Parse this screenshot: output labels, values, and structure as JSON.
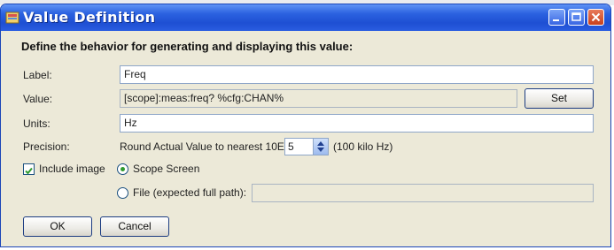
{
  "window": {
    "title": "Value Definition"
  },
  "heading": "Define the behavior for generating and displaying this value:",
  "label": {
    "caption": "Label:",
    "value": "Freq"
  },
  "value": {
    "caption": "Value:",
    "value": "[scope]:meas:freq? %cfg:CHAN%",
    "set_label": "Set"
  },
  "units": {
    "caption": "Units:",
    "value": "Hz"
  },
  "precision": {
    "caption": "Precision:",
    "text": "Round Actual Value to nearest 10E",
    "value": "5",
    "hint": "(100 kilo Hz)"
  },
  "include_image": {
    "label": "Include image",
    "checked": true
  },
  "options": {
    "scope_screen": {
      "label": "Scope Screen",
      "selected": true
    },
    "file": {
      "label": "File (expected full path):",
      "selected": false,
      "value": ""
    }
  },
  "buttons": {
    "ok": "OK",
    "cancel": "Cancel"
  },
  "icons": {
    "app": "app-icon",
    "minimize": "minimize-icon",
    "maximize": "maximize-icon",
    "close": "close-icon",
    "spinner": "spinner-arrows-icon"
  },
  "colors": {
    "titlebar": "#2b62e0",
    "dialog_bg": "#ece9d8",
    "close": "#c8401c",
    "radio_dot": "#2f9a2f",
    "check": "#2f9a2f"
  }
}
